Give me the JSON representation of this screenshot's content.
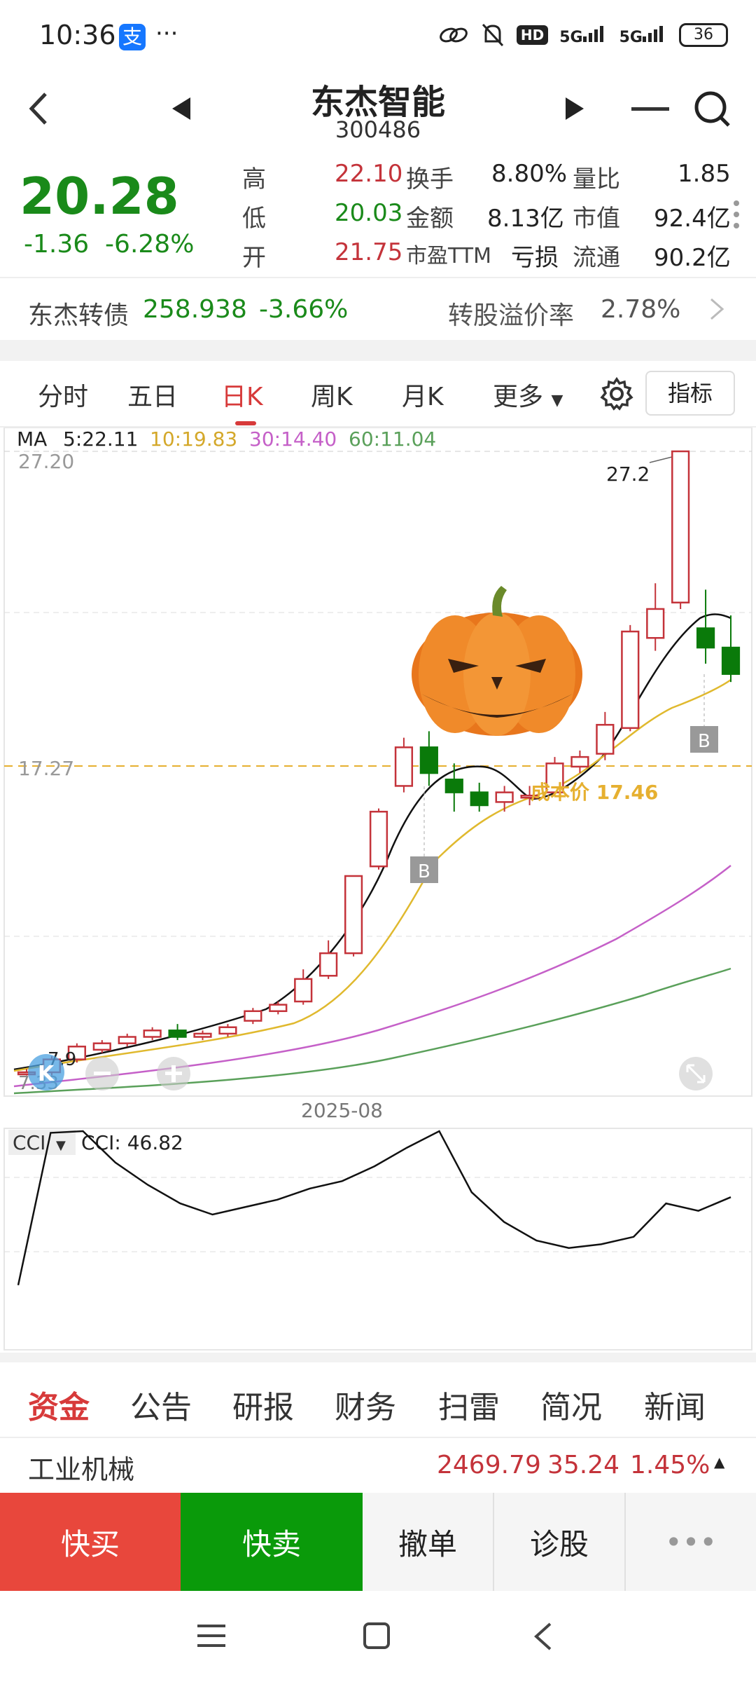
{
  "status": {
    "time": "10:36",
    "alipay": "支",
    "dots": "···",
    "hd": "HD",
    "net1": "5G",
    "net2": "5G",
    "battery": "36"
  },
  "header": {
    "title": "东杰智能",
    "code": "300486"
  },
  "quote": {
    "price": "20.28",
    "change": "-1.36",
    "change_pct": "-6.28%",
    "rows": [
      {
        "l1": "高",
        "v1": "22.10",
        "l2": "换手",
        "v2": "8.80%",
        "l3": "量比",
        "v3": "1.85"
      },
      {
        "l1": "低",
        "v1": "20.03",
        "l2": "金额",
        "v2": "8.13亿",
        "l3": "市值",
        "v3": "92.4亿"
      },
      {
        "l1": "开",
        "v1": "21.75",
        "l2": "市盈TTM",
        "v2": "亏损",
        "l3": "流通",
        "v3": "90.2亿"
      }
    ]
  },
  "bond": {
    "name": "东杰转债",
    "price": "258.938",
    "pct": "-3.66%",
    "premium_label": "转股溢价率",
    "premium": "2.78%"
  },
  "tabs": [
    "分时",
    "五日",
    "日K",
    "周K",
    "月K",
    "更多"
  ],
  "active_tab": "日K",
  "indicator_button": "指标",
  "ma_legend": {
    "label": "MA",
    "ma5": "5:22.11",
    "ma10": "10:19.83",
    "ma30": "30:14.40",
    "ma60": "60:11.04"
  },
  "colors": {
    "up": "#c4333a",
    "down": "#0a7a0a",
    "ma5": "#111111",
    "ma10": "#e0b92e",
    "ma30": "#c560c8",
    "ma60": "#5aa05a",
    "cost": "#e6b030"
  },
  "chart_labels": {
    "top_price": "27.20",
    "mid_price": "17.27",
    "peak": "27.2",
    "low": "7.9",
    "low2": "7.33",
    "date": "2025-08",
    "cost": "成本价 17.46",
    "buy_mark": "B",
    "k_mark": "K"
  },
  "cci": {
    "label": "CCI",
    "value": "CCI: 46.82"
  },
  "chart_data": [
    {
      "type": "candlestick",
      "ylim": [
        7.33,
        27.2
      ],
      "candles": [
        {
          "o": 7.9,
          "c": 7.9,
          "h": 8.0,
          "l": 7.8
        },
        {
          "o": 7.9,
          "c": 8.3,
          "h": 8.4,
          "l": 7.8
        },
        {
          "o": 8.3,
          "c": 8.7,
          "h": 8.8,
          "l": 8.2
        },
        {
          "o": 8.6,
          "c": 8.8,
          "h": 8.9,
          "l": 8.5
        },
        {
          "o": 8.8,
          "c": 9.0,
          "h": 9.1,
          "l": 8.7
        },
        {
          "o": 9.0,
          "c": 9.2,
          "h": 9.3,
          "l": 8.9
        },
        {
          "o": 9.2,
          "c": 9.0,
          "h": 9.4,
          "l": 8.9
        },
        {
          "o": 9.0,
          "c": 9.1,
          "h": 9.2,
          "l": 8.9
        },
        {
          "o": 9.1,
          "c": 9.3,
          "h": 9.4,
          "l": 9.0
        },
        {
          "o": 9.5,
          "c": 9.8,
          "h": 9.9,
          "l": 9.4
        },
        {
          "o": 9.8,
          "c": 10.0,
          "h": 10.1,
          "l": 9.7
        },
        {
          "o": 10.1,
          "c": 10.8,
          "h": 11.1,
          "l": 10.0
        },
        {
          "o": 10.9,
          "c": 11.6,
          "h": 12.0,
          "l": 10.8
        },
        {
          "o": 11.6,
          "c": 14.0,
          "h": 14.0,
          "l": 11.5
        },
        {
          "o": 14.3,
          "c": 16.0,
          "h": 16.1,
          "l": 14.2
        },
        {
          "o": 16.8,
          "c": 18.0,
          "h": 18.3,
          "l": 16.6
        },
        {
          "o": 18.0,
          "c": 17.2,
          "h": 18.5,
          "l": 16.8
        },
        {
          "o": 17.0,
          "c": 16.6,
          "h": 17.5,
          "l": 16.0
        },
        {
          "o": 16.6,
          "c": 16.2,
          "h": 16.9,
          "l": 16.0
        },
        {
          "o": 16.3,
          "c": 16.6,
          "h": 16.8,
          "l": 16.0
        },
        {
          "o": 16.5,
          "c": 16.5,
          "h": 16.8,
          "l": 16.2
        },
        {
          "o": 16.6,
          "c": 17.5,
          "h": 17.7,
          "l": 16.5
        },
        {
          "o": 17.4,
          "c": 17.7,
          "h": 17.9,
          "l": 17.2
        },
        {
          "o": 17.8,
          "c": 18.7,
          "h": 19.1,
          "l": 17.6
        },
        {
          "o": 18.6,
          "c": 21.6,
          "h": 21.8,
          "l": 18.5
        },
        {
          "o": 21.4,
          "c": 22.3,
          "h": 23.1,
          "l": 21.0
        },
        {
          "o": 22.5,
          "c": 27.2,
          "h": 27.2,
          "l": 22.3
        },
        {
          "o": 21.7,
          "c": 21.1,
          "h": 22.9,
          "l": 20.6
        },
        {
          "o": 21.1,
          "c": 20.28,
          "h": 22.1,
          "l": 20.03
        }
      ],
      "ma5_end": 22.11,
      "ma10_end": 19.83,
      "ma30_end": 14.4,
      "ma60_end": 11.04,
      "cost_line": 17.27
    },
    {
      "type": "line",
      "name": "CCI",
      "values": [
        -190,
        220,
        260,
        140,
        80,
        30,
        0,
        20,
        40,
        70,
        90,
        130,
        180,
        230,
        60,
        -20,
        -70,
        -90,
        -80,
        -60,
        30,
        10,
        46.82
      ]
    }
  ]
}
